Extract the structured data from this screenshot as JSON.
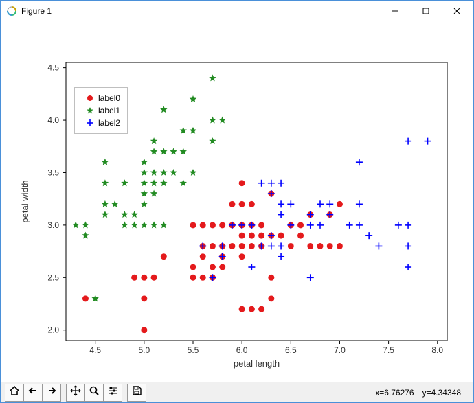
{
  "window": {
    "title": "Figure 1"
  },
  "toolbar": {
    "coord_x_label": "x=6.76276",
    "coord_y_label": "y=4.34348"
  },
  "legend": {
    "items": [
      {
        "label": "label0"
      },
      {
        "label": "label1"
      },
      {
        "label": "label2"
      }
    ]
  },
  "chart_data": {
    "type": "scatter",
    "title": "",
    "xlabel": "petal length",
    "ylabel": "petal width",
    "xlim": [
      4.2,
      8.1
    ],
    "ylim": [
      1.9,
      4.55
    ],
    "xticks": [
      4.5,
      5.0,
      5.5,
      6.0,
      6.5,
      7.0,
      7.5,
      8.0
    ],
    "yticks": [
      2.0,
      2.5,
      3.0,
      3.5,
      4.0,
      4.5
    ],
    "series": [
      {
        "name": "label0",
        "marker": "circle",
        "color": "#e41a1c",
        "points": [
          {
            "x": 5.0,
            "y": 2.0
          },
          {
            "x": 5.0,
            "y": 2.3
          },
          {
            "x": 4.4,
            "y": 2.3
          },
          {
            "x": 4.9,
            "y": 2.5
          },
          {
            "x": 5.0,
            "y": 2.5
          },
          {
            "x": 5.1,
            "y": 2.5
          },
          {
            "x": 5.5,
            "y": 2.6
          },
          {
            "x": 5.7,
            "y": 2.6
          },
          {
            "x": 5.5,
            "y": 2.5
          },
          {
            "x": 5.6,
            "y": 2.5
          },
          {
            "x": 5.2,
            "y": 2.7
          },
          {
            "x": 5.6,
            "y": 2.7
          },
          {
            "x": 5.7,
            "y": 2.5
          },
          {
            "x": 5.8,
            "y": 2.6
          },
          {
            "x": 5.8,
            "y": 2.7
          },
          {
            "x": 5.9,
            "y": 2.8
          },
          {
            "x": 5.6,
            "y": 2.8
          },
          {
            "x": 5.7,
            "y": 2.8
          },
          {
            "x": 5.8,
            "y": 2.8
          },
          {
            "x": 6.0,
            "y": 2.2
          },
          {
            "x": 6.1,
            "y": 2.2
          },
          {
            "x": 6.2,
            "y": 2.2
          },
          {
            "x": 6.0,
            "y": 2.7
          },
          {
            "x": 6.0,
            "y": 2.8
          },
          {
            "x": 6.1,
            "y": 2.8
          },
          {
            "x": 6.2,
            "y": 2.8
          },
          {
            "x": 6.3,
            "y": 2.3
          },
          {
            "x": 6.3,
            "y": 2.5
          },
          {
            "x": 6.0,
            "y": 2.9
          },
          {
            "x": 6.1,
            "y": 2.9
          },
          {
            "x": 6.2,
            "y": 2.9
          },
          {
            "x": 6.3,
            "y": 2.9
          },
          {
            "x": 6.4,
            "y": 2.9
          },
          {
            "x": 6.5,
            "y": 2.8
          },
          {
            "x": 6.6,
            "y": 2.9
          },
          {
            "x": 6.7,
            "y": 2.8
          },
          {
            "x": 6.8,
            "y": 2.8
          },
          {
            "x": 6.9,
            "y": 2.8
          },
          {
            "x": 7.0,
            "y": 2.8
          },
          {
            "x": 5.5,
            "y": 3.0
          },
          {
            "x": 5.6,
            "y": 3.0
          },
          {
            "x": 5.7,
            "y": 3.0
          },
          {
            "x": 5.8,
            "y": 3.0
          },
          {
            "x": 5.9,
            "y": 3.0
          },
          {
            "x": 6.0,
            "y": 3.0
          },
          {
            "x": 6.1,
            "y": 3.0
          },
          {
            "x": 6.2,
            "y": 3.0
          },
          {
            "x": 6.5,
            "y": 3.0
          },
          {
            "x": 6.6,
            "y": 3.0
          },
          {
            "x": 5.9,
            "y": 3.2
          },
          {
            "x": 6.0,
            "y": 3.2
          },
          {
            "x": 6.1,
            "y": 3.2
          },
          {
            "x": 7.0,
            "y": 3.2
          },
          {
            "x": 6.9,
            "y": 3.1
          },
          {
            "x": 6.7,
            "y": 3.1
          },
          {
            "x": 6.3,
            "y": 3.3
          },
          {
            "x": 6.0,
            "y": 3.4
          }
        ]
      },
      {
        "name": "label1",
        "marker": "star",
        "color": "#228b22",
        "points": [
          {
            "x": 4.3,
            "y": 3.0
          },
          {
            "x": 4.4,
            "y": 3.0
          },
          {
            "x": 4.4,
            "y": 2.9
          },
          {
            "x": 4.5,
            "y": 2.3
          },
          {
            "x": 4.6,
            "y": 3.1
          },
          {
            "x": 4.6,
            "y": 3.2
          },
          {
            "x": 4.7,
            "y": 3.2
          },
          {
            "x": 4.8,
            "y": 3.0
          },
          {
            "x": 4.8,
            "y": 3.1
          },
          {
            "x": 4.8,
            "y": 3.4
          },
          {
            "x": 4.6,
            "y": 3.4
          },
          {
            "x": 4.6,
            "y": 3.6
          },
          {
            "x": 4.9,
            "y": 3.0
          },
          {
            "x": 4.9,
            "y": 3.1
          },
          {
            "x": 5.0,
            "y": 3.0
          },
          {
            "x": 5.1,
            "y": 3.0
          },
          {
            "x": 5.2,
            "y": 3.0
          },
          {
            "x": 5.0,
            "y": 3.2
          },
          {
            "x": 5.0,
            "y": 3.3
          },
          {
            "x": 5.0,
            "y": 3.4
          },
          {
            "x": 5.0,
            "y": 3.5
          },
          {
            "x": 5.0,
            "y": 3.6
          },
          {
            "x": 5.1,
            "y": 3.3
          },
          {
            "x": 5.1,
            "y": 3.4
          },
          {
            "x": 5.1,
            "y": 3.5
          },
          {
            "x": 5.1,
            "y": 3.7
          },
          {
            "x": 5.1,
            "y": 3.8
          },
          {
            "x": 5.2,
            "y": 3.4
          },
          {
            "x": 5.2,
            "y": 3.5
          },
          {
            "x": 5.2,
            "y": 3.7
          },
          {
            "x": 5.3,
            "y": 3.5
          },
          {
            "x": 5.3,
            "y": 3.7
          },
          {
            "x": 5.4,
            "y": 3.4
          },
          {
            "x": 5.4,
            "y": 3.7
          },
          {
            "x": 5.4,
            "y": 3.9
          },
          {
            "x": 5.5,
            "y": 3.5
          },
          {
            "x": 5.5,
            "y": 3.9
          },
          {
            "x": 5.5,
            "y": 4.2
          },
          {
            "x": 5.7,
            "y": 3.8
          },
          {
            "x": 5.7,
            "y": 4.0
          },
          {
            "x": 5.7,
            "y": 4.4
          },
          {
            "x": 5.8,
            "y": 4.0
          },
          {
            "x": 5.2,
            "y": 4.1
          }
        ]
      },
      {
        "name": "label2",
        "marker": "plus",
        "color": "#0000ff",
        "points": [
          {
            "x": 5.6,
            "y": 2.8
          },
          {
            "x": 5.7,
            "y": 2.5
          },
          {
            "x": 5.8,
            "y": 2.7
          },
          {
            "x": 5.8,
            "y": 2.8
          },
          {
            "x": 5.9,
            "y": 3.0
          },
          {
            "x": 6.0,
            "y": 3.0
          },
          {
            "x": 6.1,
            "y": 2.6
          },
          {
            "x": 6.1,
            "y": 3.0
          },
          {
            "x": 6.2,
            "y": 2.8
          },
          {
            "x": 6.2,
            "y": 3.4
          },
          {
            "x": 6.3,
            "y": 2.8
          },
          {
            "x": 6.3,
            "y": 2.9
          },
          {
            "x": 6.3,
            "y": 3.3
          },
          {
            "x": 6.3,
            "y": 3.4
          },
          {
            "x": 6.4,
            "y": 2.7
          },
          {
            "x": 6.4,
            "y": 2.8
          },
          {
            "x": 6.4,
            "y": 3.1
          },
          {
            "x": 6.4,
            "y": 3.2
          },
          {
            "x": 6.5,
            "y": 3.0
          },
          {
            "x": 6.5,
            "y": 3.2
          },
          {
            "x": 6.4,
            "y": 3.4
          },
          {
            "x": 6.7,
            "y": 2.5
          },
          {
            "x": 6.7,
            "y": 3.0
          },
          {
            "x": 6.7,
            "y": 3.1
          },
          {
            "x": 6.8,
            "y": 3.0
          },
          {
            "x": 6.8,
            "y": 3.2
          },
          {
            "x": 6.9,
            "y": 3.1
          },
          {
            "x": 6.9,
            "y": 3.2
          },
          {
            "x": 7.1,
            "y": 3.0
          },
          {
            "x": 7.2,
            "y": 3.0
          },
          {
            "x": 7.2,
            "y": 3.2
          },
          {
            "x": 7.2,
            "y": 3.6
          },
          {
            "x": 7.3,
            "y": 2.9
          },
          {
            "x": 7.4,
            "y": 2.8
          },
          {
            "x": 7.6,
            "y": 3.0
          },
          {
            "x": 7.7,
            "y": 2.6
          },
          {
            "x": 7.7,
            "y": 2.8
          },
          {
            "x": 7.7,
            "y": 3.0
          },
          {
            "x": 7.7,
            "y": 3.8
          },
          {
            "x": 7.9,
            "y": 3.8
          }
        ]
      }
    ]
  }
}
